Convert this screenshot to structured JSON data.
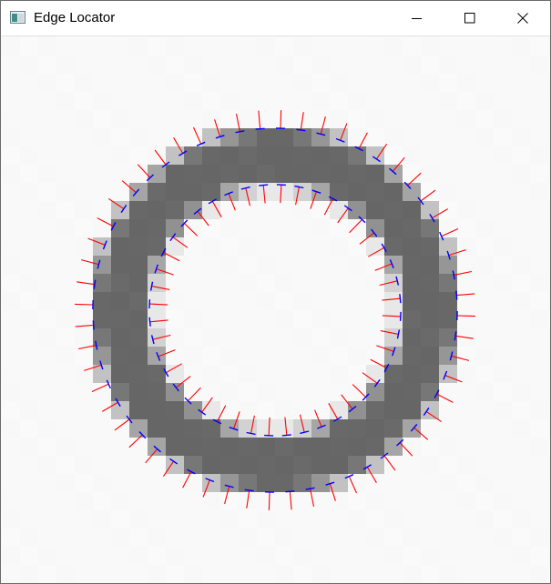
{
  "window": {
    "title": "Edge Locator",
    "icon": "app-window-icon"
  },
  "title_bar": {
    "buttons": [
      {
        "name": "minimize",
        "icon": "minimize-icon"
      },
      {
        "name": "maximize",
        "icon": "maximize-icon"
      },
      {
        "name": "close",
        "icon": "close-icon"
      }
    ]
  },
  "colors": {
    "background_pixel": "#fafafa",
    "ring_fill": "#666666",
    "edge_pixel_light": "#cfcfcf",
    "edge_pixel_mid": "#9a9a9a",
    "normal_vector": "#ff0000",
    "edge_tangent": "#0000ff"
  },
  "image": {
    "description_shape": "annulus",
    "outer_edge_markers": 56,
    "inner_edge_markers": 44
  }
}
